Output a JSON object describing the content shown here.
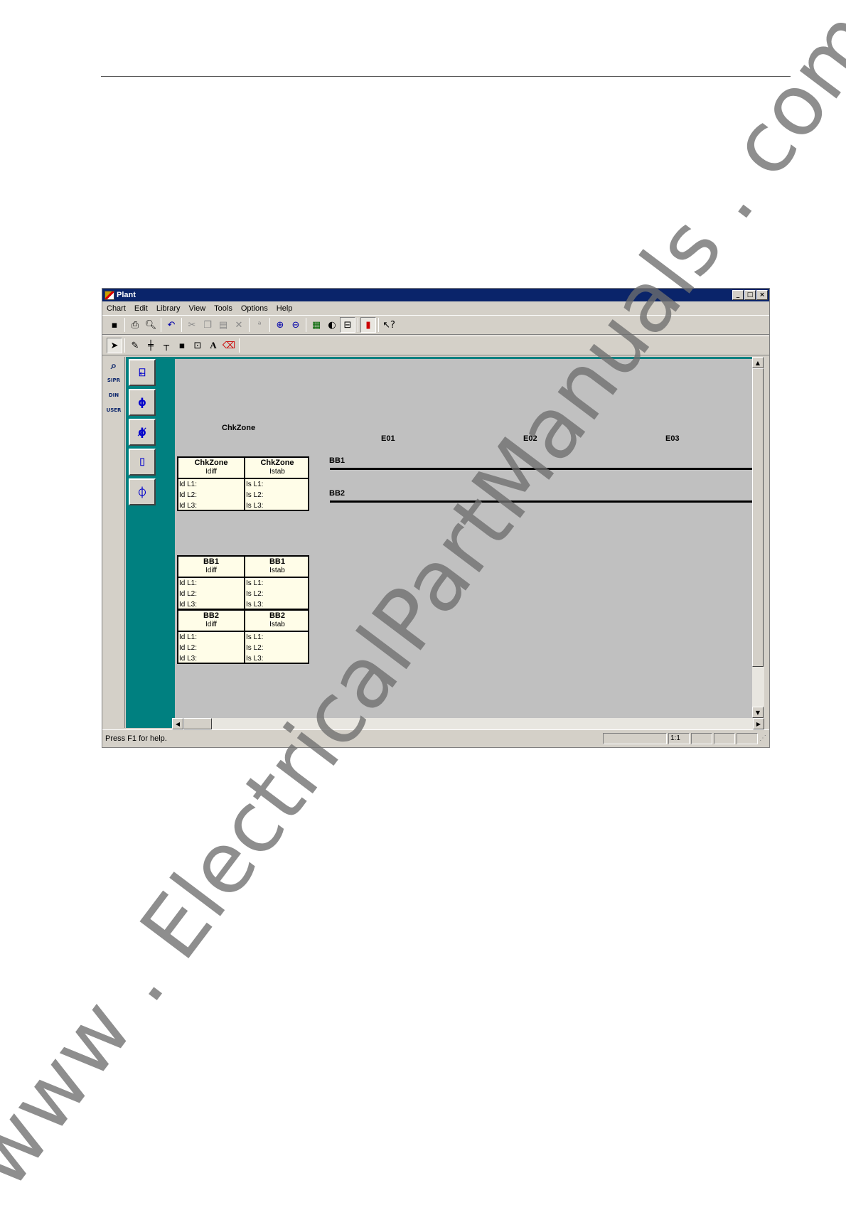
{
  "window": {
    "title": "Plant",
    "controls": [
      "_",
      "□",
      "×"
    ]
  },
  "menu": [
    "Chart",
    "Edit",
    "Library",
    "View",
    "Tools",
    "Options",
    "Help"
  ],
  "toolbar1": {
    "icons": [
      "save-icon",
      "print-icon",
      "print-preview-icon",
      "undo-icon",
      "cut-icon",
      "copy-icon",
      "paste-icon",
      "delete-icon",
      "format-icon",
      "zoom-in-icon",
      "zoom-out-icon",
      "grid-icon",
      "contrast-icon",
      "toggle-panel-icon",
      "color-icon",
      "context-help-icon"
    ]
  },
  "toolbar2": {
    "icons": [
      "pointer-icon",
      "pen-icon",
      "busbar-icon",
      "feeder-icon",
      "dot-icon",
      "textbox-icon",
      "text-icon",
      "eraser-icon"
    ]
  },
  "palette": {
    "small": [
      "SIPR",
      "DIN",
      "USER"
    ],
    "shapes": [
      "isolator-shape",
      "circuit-breaker-shape",
      "breaker-feeder-shape",
      "current-transformer-shape",
      "disconnector-shape"
    ]
  },
  "canvas": {
    "labels": {
      "chkzone_title": "ChkZone",
      "e01": "E01",
      "e02": "E02",
      "e03": "E03",
      "bb1": "BB1",
      "bb2": "BB2"
    },
    "tables": [
      {
        "left": {
          "name": "ChkZone",
          "sub": "Idiff",
          "rows": [
            "Id L1:",
            "Id L2:",
            "Id L3:"
          ]
        },
        "right": {
          "name": "ChkZone",
          "sub": "Istab",
          "rows": [
            "Is L1:",
            "Is L2:",
            "Is L3:"
          ]
        }
      },
      {
        "left": {
          "name": "BB1",
          "sub": "Idiff",
          "rows": [
            "Id L1:",
            "Id L2:",
            "Id L3:"
          ]
        },
        "right": {
          "name": "BB1",
          "sub": "Istab",
          "rows": [
            "Is L1:",
            "Is L2:",
            "Is L3:"
          ]
        }
      },
      {
        "left": {
          "name": "BB2",
          "sub": "Idiff",
          "rows": [
            "Id L1:",
            "Id L2:",
            "Id L3:"
          ]
        },
        "right": {
          "name": "BB2",
          "sub": "Istab",
          "rows": [
            "Is L1:",
            "Is L2:",
            "Is L3:"
          ]
        }
      }
    ]
  },
  "status": {
    "help": "Press F1 for help.",
    "zoom": "1:1"
  },
  "watermark": "www . ElectricalPartManuals . com"
}
